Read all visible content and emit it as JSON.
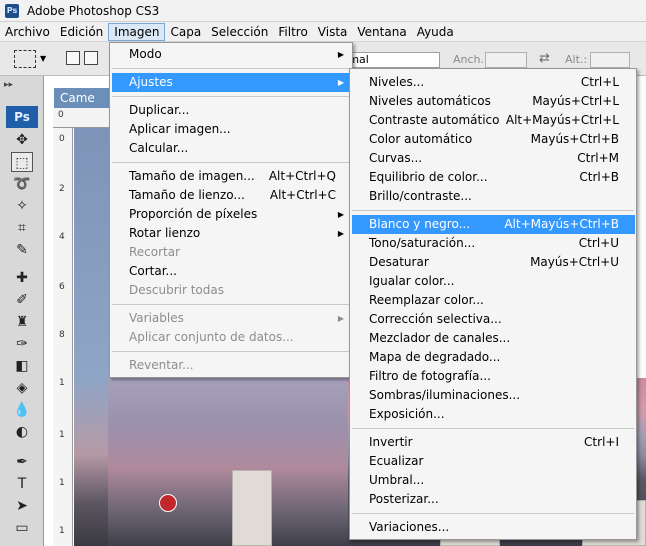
{
  "window": {
    "title": "Adobe Photoshop CS3",
    "app_badge": "Ps"
  },
  "menubar": [
    "Archivo",
    "Edición",
    "Imagen",
    "Capa",
    "Selección",
    "Filtro",
    "Vista",
    "Ventana",
    "Ayuda"
  ],
  "menubar_active": "Imagen",
  "options_bar": {
    "style_value": "rmal",
    "width_label": "Anch.:",
    "height_label": "Alt.:",
    "swap_icon": "⇄"
  },
  "toolbox": {
    "badge": "Ps"
  },
  "document": {
    "tab_title": "Came",
    "ruler_numbers": [
      "0",
      "2",
      "4",
      "6",
      "8",
      "1",
      "1",
      "1",
      "1"
    ]
  },
  "imagen_menu": {
    "items": [
      {
        "label": "Modo",
        "shortcut": "",
        "submenu": true
      },
      {
        "separator": true
      },
      {
        "label": "Ajustes",
        "shortcut": "",
        "submenu": true,
        "highlighted": true
      },
      {
        "separator": true
      },
      {
        "label": "Duplicar...",
        "shortcut": ""
      },
      {
        "label": "Aplicar imagen...",
        "shortcut": ""
      },
      {
        "label": "Calcular...",
        "shortcut": ""
      },
      {
        "separator": true
      },
      {
        "label": "Tamaño de imagen...",
        "shortcut": "Alt+Ctrl+Q"
      },
      {
        "label": "Tamaño de lienzo...",
        "shortcut": "Alt+Ctrl+C"
      },
      {
        "label": "Proporción de píxeles",
        "shortcut": "",
        "submenu": true
      },
      {
        "label": "Rotar lienzo",
        "shortcut": "",
        "submenu": true
      },
      {
        "label": "Recortar",
        "shortcut": "",
        "disabled": true
      },
      {
        "label": "Cortar...",
        "shortcut": ""
      },
      {
        "label": "Descubrir todas",
        "shortcut": "",
        "disabled": true
      },
      {
        "separator": true
      },
      {
        "label": "Variables",
        "shortcut": "",
        "submenu": true,
        "disabled": true
      },
      {
        "label": "Aplicar conjunto de datos...",
        "shortcut": "",
        "disabled": true
      },
      {
        "separator": true
      },
      {
        "label": "Reventar...",
        "shortcut": "",
        "disabled": true
      }
    ]
  },
  "ajustes_menu": {
    "items": [
      {
        "label": "Niveles...",
        "shortcut": "Ctrl+L"
      },
      {
        "label": "Niveles automáticos",
        "shortcut": "Mayús+Ctrl+L"
      },
      {
        "label": "Contraste automático",
        "shortcut": "Alt+Mayús+Ctrl+L"
      },
      {
        "label": "Color automático",
        "shortcut": "Mayús+Ctrl+B"
      },
      {
        "label": "Curvas...",
        "shortcut": "Ctrl+M"
      },
      {
        "label": "Equilibrio de color...",
        "shortcut": "Ctrl+B"
      },
      {
        "label": "Brillo/contraste...",
        "shortcut": ""
      },
      {
        "separator": true
      },
      {
        "label": "Blanco y negro...",
        "shortcut": "Alt+Mayús+Ctrl+B",
        "highlighted": true
      },
      {
        "label": "Tono/saturación...",
        "shortcut": "Ctrl+U"
      },
      {
        "label": "Desaturar",
        "shortcut": "Mayús+Ctrl+U"
      },
      {
        "label": "Igualar color...",
        "shortcut": ""
      },
      {
        "label": "Reemplazar color...",
        "shortcut": ""
      },
      {
        "label": "Corrección selectiva...",
        "shortcut": ""
      },
      {
        "label": "Mezclador de canales...",
        "shortcut": ""
      },
      {
        "label": "Mapa de degradado...",
        "shortcut": ""
      },
      {
        "label": "Filtro de fotografía...",
        "shortcut": ""
      },
      {
        "label": "Sombras/iluminaciones...",
        "shortcut": ""
      },
      {
        "label": "Exposición...",
        "shortcut": ""
      },
      {
        "separator": true
      },
      {
        "label": "Invertir",
        "shortcut": "Ctrl+I"
      },
      {
        "label": "Ecualizar",
        "shortcut": ""
      },
      {
        "label": "Umbral...",
        "shortcut": ""
      },
      {
        "label": "Posterizar...",
        "shortcut": ""
      },
      {
        "separator": true
      },
      {
        "label": "Variaciones...",
        "shortcut": ""
      }
    ]
  },
  "colors": {
    "highlight": "#3399ff",
    "menu_bg": "#f5f5f5",
    "disabled_text": "#8d8d8d",
    "ps_blue": "#1f5ea8"
  }
}
